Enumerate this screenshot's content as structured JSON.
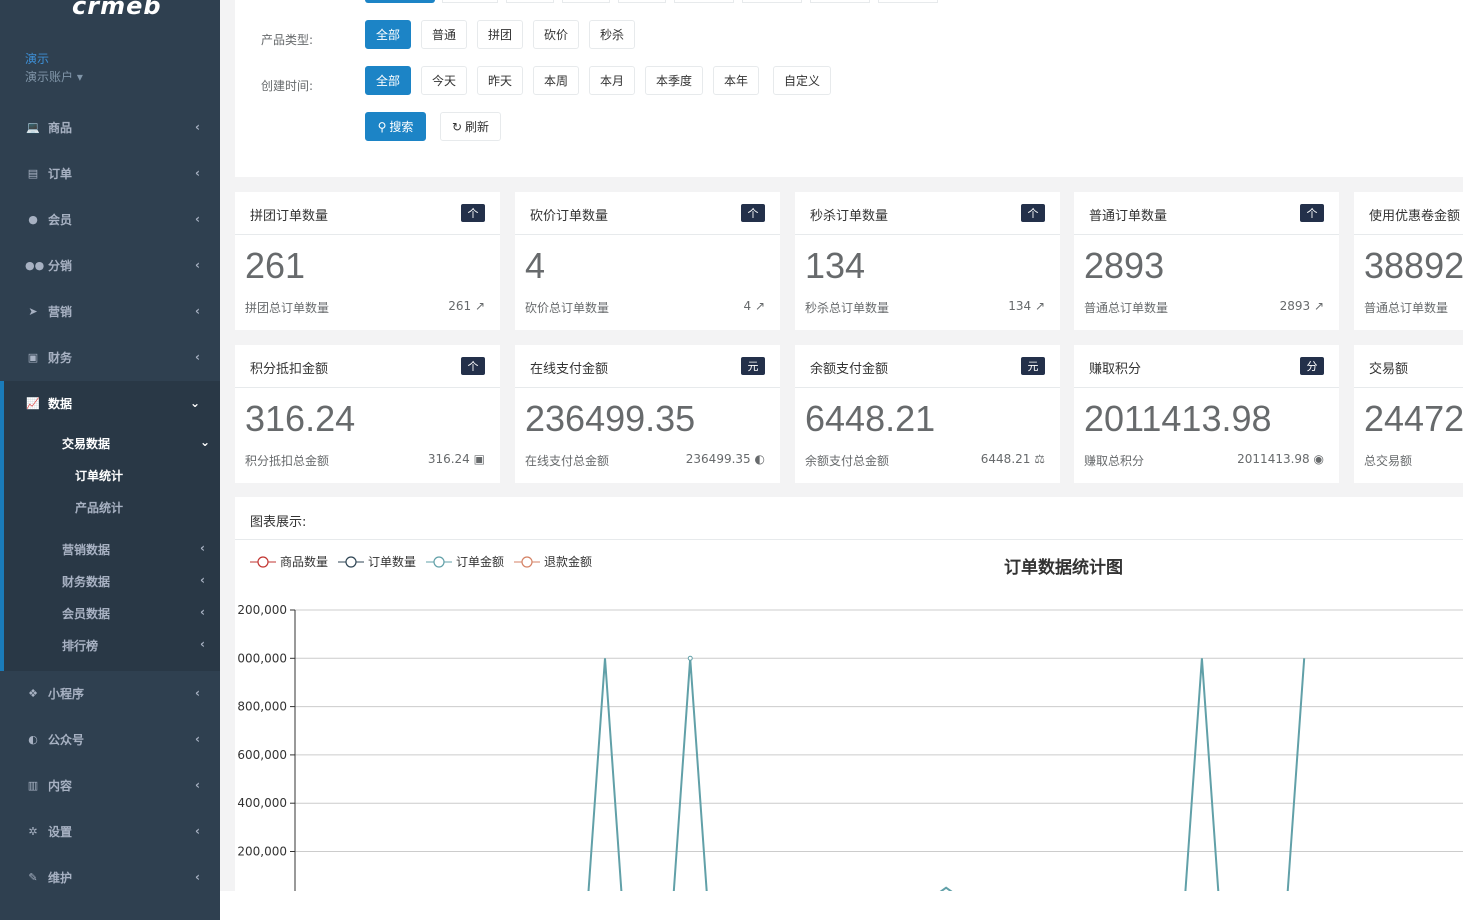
{
  "app": {
    "logo": "crmeb"
  },
  "profile": {
    "name": "演示",
    "role": "演示账户 ▾"
  },
  "sidebar": {
    "items": [
      {
        "label": "商品",
        "icon": "laptop-icon",
        "glyph": "💻"
      },
      {
        "label": "订单",
        "icon": "file-icon",
        "glyph": "▤"
      },
      {
        "label": "会员",
        "icon": "user-icon",
        "glyph": "●"
      },
      {
        "label": "分销",
        "icon": "users-icon",
        "glyph": "●●"
      },
      {
        "label": "营销",
        "icon": "paper-plane-icon",
        "glyph": "➤"
      },
      {
        "label": "财务",
        "icon": "money-icon",
        "glyph": "▣"
      },
      {
        "label": "数据",
        "icon": "line-chart-icon",
        "glyph": "📈"
      },
      {
        "label": "小程序",
        "icon": "cubes-icon",
        "glyph": "❖"
      },
      {
        "label": "公众号",
        "icon": "wechat-icon",
        "glyph": "◐"
      },
      {
        "label": "内容",
        "icon": "book-icon",
        "glyph": "▥"
      },
      {
        "label": "设置",
        "icon": "cog-icon",
        "glyph": "✲"
      },
      {
        "label": "维护",
        "icon": "magic-icon",
        "glyph": "✎"
      }
    ],
    "data_submenu": {
      "trade": "交易数据",
      "order_stats": "订单统计",
      "product_stats": "产品统计",
      "marketing": "营销数据",
      "finance": "财务数据",
      "member": "会员数据",
      "ranking": "排行榜"
    }
  },
  "filters": {
    "product_type_label": "产品类型:",
    "product_types": [
      "全部",
      "普通",
      "拼团",
      "砍价",
      "秒杀"
    ],
    "created_label": "创建时间:",
    "created_options": [
      "全部",
      "今天",
      "昨天",
      "本周",
      "本月",
      "本季度",
      "本年",
      "自定义"
    ],
    "search_label": "搜索",
    "refresh_label": "刷新"
  },
  "cards_row1": [
    {
      "title": "拼团订单数量",
      "badge": "个",
      "value": "261",
      "foot": "拼团总订单数量",
      "foot_value": "261",
      "foot_icon": "line-chart-icon",
      "foot_glyph": "↗"
    },
    {
      "title": "砍价订单数量",
      "badge": "个",
      "value": "4",
      "foot": "砍价总订单数量",
      "foot_value": "4",
      "foot_icon": "line-chart-icon",
      "foot_glyph": "↗"
    },
    {
      "title": "秒杀订单数量",
      "badge": "个",
      "value": "134",
      "foot": "秒杀总订单数量",
      "foot_value": "134",
      "foot_icon": "line-chart-icon",
      "foot_glyph": "↗"
    },
    {
      "title": "普通订单数量",
      "badge": "个",
      "value": "2893",
      "foot": "普通总订单数量",
      "foot_value": "2893",
      "foot_icon": "line-chart-icon",
      "foot_glyph": "↗"
    },
    {
      "title": "使用优惠卷金额",
      "badge": "",
      "value": "38892",
      "foot": "普通总订单数量",
      "foot_value": "",
      "foot_icon": "",
      "foot_glyph": ""
    }
  ],
  "cards_row2": [
    {
      "title": "积分抵扣金额",
      "badge": "个",
      "value": "316.24",
      "foot": "积分抵扣总金额",
      "foot_value": "316.24",
      "foot_icon": "money-icon",
      "foot_glyph": "▣"
    },
    {
      "title": "在线支付金额",
      "badge": "元",
      "value": "236499.35",
      "foot": "在线支付总金额",
      "foot_value": "236499.35",
      "foot_icon": "wechat-icon",
      "foot_glyph": "◐"
    },
    {
      "title": "余额支付金额",
      "badge": "元",
      "value": "6448.21",
      "foot": "余额支付总金额",
      "foot_value": "6448.21",
      "foot_icon": "balance-scale-icon",
      "foot_glyph": "⚖"
    },
    {
      "title": "赚取积分",
      "badge": "分",
      "value": "2011413.98",
      "foot": "赚取总积分",
      "foot_value": "2011413.98",
      "foot_icon": "eye-icon",
      "foot_glyph": "◉"
    },
    {
      "title": "交易额",
      "badge": "",
      "value": "24472",
      "foot": "总交易额",
      "foot_value": "",
      "foot_icon": "",
      "foot_glyph": ""
    }
  ],
  "chart_panel": {
    "heading": "图表展示:"
  },
  "colors": {
    "sidebar_bg": "#2f4050",
    "accent_blue": "#1c84c6",
    "series_order_amount": "#5b9ea6"
  },
  "chart_data": {
    "type": "line",
    "title": "订单数据统计图",
    "legend": [
      "商品数量",
      "订单数量",
      "订单金额",
      "退款金额"
    ],
    "legend_colors": [
      "#c23531",
      "#2f4554",
      "#61a0a8",
      "#d48265"
    ],
    "y_tick_labels": [
      "200,000",
      "000,000",
      "800,000",
      "600,000",
      "400,000",
      "200,000"
    ],
    "y_tick_values": [
      1200000,
      1000000,
      800000,
      600000,
      400000,
      200000
    ],
    "ylim": [
      0,
      1200000
    ],
    "n_points": 60,
    "series": [
      {
        "name": "订单金额",
        "color": "#61a0a8",
        "values": [
          0,
          0,
          0,
          0,
          0,
          0,
          0,
          0,
          0,
          0,
          0,
          0,
          0,
          0,
          0,
          0,
          0,
          0,
          1000000,
          0,
          0,
          0,
          0,
          1000000,
          0,
          0,
          0,
          0,
          0,
          0,
          0,
          0,
          0,
          0,
          0,
          0,
          0,
          0,
          50000,
          0,
          0,
          0,
          0,
          0,
          0,
          0,
          0,
          0,
          0,
          0,
          0,
          0,
          0,
          1000000,
          0,
          0,
          0,
          0,
          0,
          1000000
        ]
      }
    ]
  }
}
